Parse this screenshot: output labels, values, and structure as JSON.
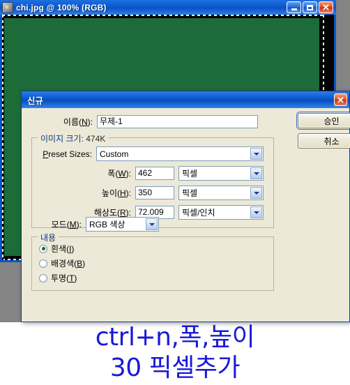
{
  "image_window": {
    "title": "chi.jpg @ 100% (RGB)",
    "icon": "photoshop-document-icon",
    "canvas_color": "#1e6b3a",
    "buttons": {
      "minimize": "minimize-icon",
      "maximize": "maximize-icon",
      "close": "✕"
    }
  },
  "dialog": {
    "title": "신규",
    "close_label": "✕",
    "name": {
      "label": "이름(N):",
      "label_prefix": "이름(",
      "label_key": "N",
      "label_suffix": "):",
      "value": "무제-1"
    },
    "ok_label": "승인",
    "cancel_label": "취소",
    "image_size_group": {
      "legend_main": "이미지 크기",
      "legend_size": ": 474K",
      "preset": {
        "label": "Preset Sizes:",
        "label_key": "P",
        "label_prefix": "",
        "label_suffix": "reset Sizes:",
        "value": "Custom"
      },
      "width": {
        "label_prefix": "폭(",
        "label_key": "W",
        "label_suffix": "):",
        "value": "462",
        "unit": "픽셀"
      },
      "height": {
        "label_prefix": "높이(",
        "label_key": "H",
        "label_suffix": "):",
        "value": "350",
        "unit": "픽셀"
      },
      "resolution": {
        "label_prefix": "해상도(",
        "label_key": "R",
        "label_suffix": "):",
        "value": "72.009",
        "unit": "픽셀/인치"
      },
      "mode": {
        "label_prefix": "모드(",
        "label_key": "M",
        "label_suffix": "):",
        "value": "RGB 색상"
      }
    },
    "contents_group": {
      "legend": "내용",
      "options": [
        {
          "prefix": "흰색(",
          "key": "I",
          "suffix": ")",
          "selected": true
        },
        {
          "prefix": "배경색(",
          "key": "B",
          "suffix": ")",
          "selected": false
        },
        {
          "prefix": "투명(",
          "key": "T",
          "suffix": ")",
          "selected": false
        }
      ]
    }
  },
  "annotation": {
    "line1": "ctrl+n,폭,높이",
    "line2": "30 픽셀추가",
    "color": "#1919d8"
  }
}
